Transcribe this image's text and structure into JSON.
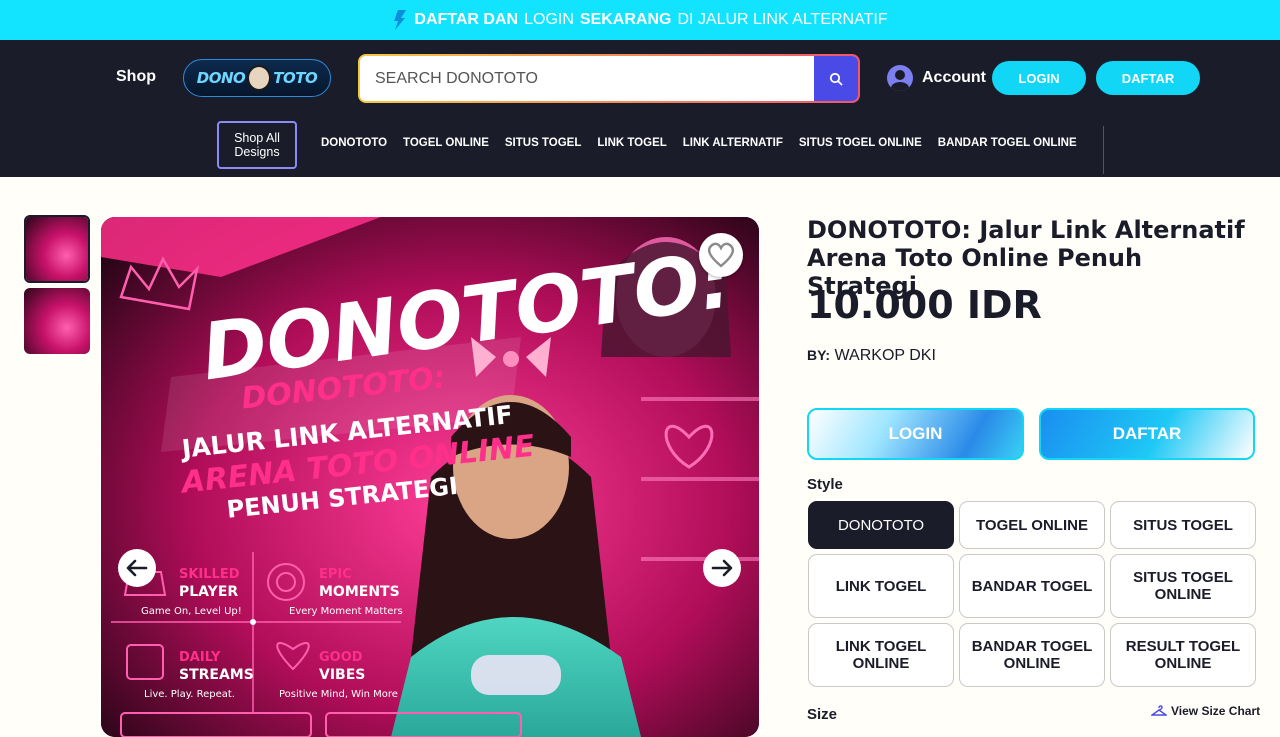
{
  "promo": {
    "part1": "DAFTAR DAN",
    "part2": "LOGIN",
    "part3": "SEKARANG",
    "part4": "DI JALUR LINK ALTERNATIF",
    "icon": "bolt-icon"
  },
  "header": {
    "shop_label": "Shop",
    "logo_text_left": "DONO",
    "logo_text_right": "TOTO",
    "search_placeholder": "SEARCH DONOTOTO",
    "account_label": "Account",
    "login_label": "LOGIN",
    "daftar_label": "DAFTAR",
    "shop_all_label": "Shop All Designs",
    "nav": [
      "DONOTOTO",
      "TOGEL ONLINE",
      "SITUS TOGEL",
      "LINK TOGEL",
      "LINK ALTERNATIF",
      "SITUS TOGEL ONLINE",
      "BANDAR TOGEL ONLINE"
    ]
  },
  "hero": {
    "big_title": "DONOTOTO:",
    "sub1": "DONOTOTO:",
    "sub2": "JALUR LINK ALTERNATIF",
    "sub3": "ARENA TOTO ONLINE",
    "sub4": "PENUH STRATEGI",
    "features": [
      {
        "top": "SKILLED",
        "bottom": "PLAYER",
        "caption": "Game On, Level Up!"
      },
      {
        "top": "EPIC",
        "bottom": "MOMENTS",
        "caption": "Every Moment Matters"
      },
      {
        "top": "DAILY",
        "bottom": "STREAMS",
        "caption": "Live. Play. Repeat."
      },
      {
        "top": "GOOD",
        "bottom": "VIBES",
        "caption": "Positive Mind, Win More"
      }
    ]
  },
  "product": {
    "title": "DONOTOTO: Jalur Link Alternatif Arena Toto Online Penuh Strategi",
    "price": "10.000 IDR",
    "by_label": "BY:",
    "by_value": "WARKOP DKI",
    "login_label": "LOGIN",
    "daftar_label": "DAFTAR",
    "style_label": "Style",
    "styles": [
      "DONOTOTO",
      "TOGEL ONLINE",
      "SITUS TOGEL",
      "LINK TOGEL",
      "BANDAR TOGEL",
      "SITUS TOGEL ONLINE",
      "LINK TOGEL ONLINE",
      "BANDAR TOGEL ONLINE",
      "RESULT TOGEL ONLINE"
    ],
    "selected_style": "DONOTOTO",
    "size_label": "Size",
    "size_chart_label": "View Size Chart"
  },
  "colors": {
    "promo_bar": "#12e3ff",
    "header_bg": "#1b1c2a",
    "accent_cyan": "#12d6f5",
    "search_button": "#4a4ae6",
    "hero_pink": "#ff2f8a"
  }
}
